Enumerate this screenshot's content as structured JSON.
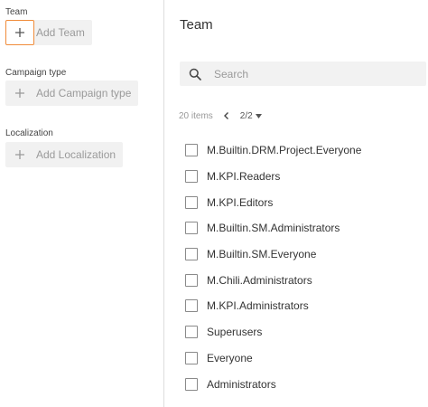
{
  "left": {
    "team": {
      "label": "Team",
      "button": "Add Team"
    },
    "campaign_type": {
      "label": "Campaign type",
      "button": "Add Campaign type"
    },
    "localization": {
      "label": "Localization",
      "button": "Add Localization"
    }
  },
  "main": {
    "title": "Team",
    "search": {
      "placeholder": "Search",
      "icon": "search-icon"
    },
    "pager": {
      "count": "20 items",
      "page": "2/2"
    },
    "items": [
      {
        "label": "M.Builtin.DRM.Project.Everyone",
        "checked": false
      },
      {
        "label": "M.KPI.Readers",
        "checked": false
      },
      {
        "label": "M.KPI.Editors",
        "checked": false
      },
      {
        "label": "M.Builtin.SM.Administrators",
        "checked": false
      },
      {
        "label": "M.Builtin.SM.Everyone",
        "checked": false
      },
      {
        "label": "M.Chili.Administrators",
        "checked": false
      },
      {
        "label": "M.KPI.Administrators",
        "checked": false
      },
      {
        "label": "Superusers",
        "checked": false
      },
      {
        "label": "Everyone",
        "checked": false
      },
      {
        "label": "Administrators",
        "checked": false
      }
    ]
  },
  "colors": {
    "focus_border": "#f08c3a",
    "button_bg": "#f1f1f1",
    "search_bg": "#f2f2f2"
  }
}
